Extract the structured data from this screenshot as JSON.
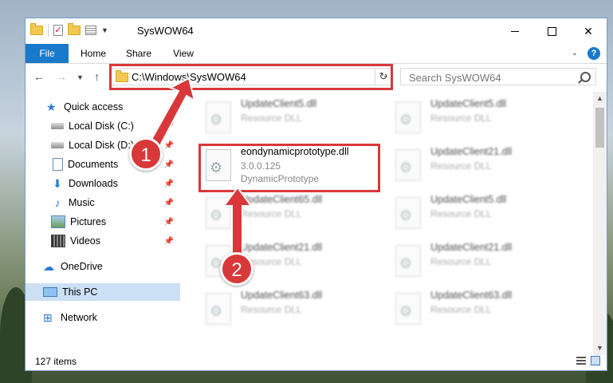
{
  "window": {
    "title": "SysWOW64"
  },
  "ribbon": {
    "tabs": [
      "File",
      "Home",
      "Share",
      "View"
    ]
  },
  "nav": {
    "address": "C:\\Windows\\SysWOW64",
    "search_placeholder": "Search SysWOW64"
  },
  "sidebar": {
    "items": [
      {
        "label": "Quick access",
        "icon": "star-icon"
      },
      {
        "label": "Local Disk (C:)",
        "icon": "disk-icon"
      },
      {
        "label": "Local Disk (D:)",
        "icon": "disk-icon"
      },
      {
        "label": "Documents",
        "icon": "document-icon"
      },
      {
        "label": "Downloads",
        "icon": "download-icon"
      },
      {
        "label": "Music",
        "icon": "music-icon"
      },
      {
        "label": "Pictures",
        "icon": "pictures-icon"
      },
      {
        "label": "Videos",
        "icon": "video-icon"
      },
      {
        "label": "OneDrive",
        "icon": "cloud-icon"
      },
      {
        "label": "This PC",
        "icon": "computer-icon"
      },
      {
        "label": "Network",
        "icon": "network-icon"
      }
    ]
  },
  "files": [
    {
      "name": "UpdateClient5.dll",
      "line1": "Resource DLL",
      "line2": ""
    },
    {
      "name": "UpdateClient5.dll",
      "line1": "Resource DLL",
      "line2": ""
    },
    {
      "name": "eondynamicprototype.dll",
      "line1": "3.0.0.125",
      "line2": "DynamicPrototype"
    },
    {
      "name": "UpdateClient21.dll",
      "line1": "Resource DLL",
      "line2": ""
    },
    {
      "name": "UpdateClient65.dll",
      "line1": "Resource DLL",
      "line2": ""
    },
    {
      "name": "UpdateClient5.dll",
      "line1": "Resource DLL",
      "line2": ""
    },
    {
      "name": "UpdateClient21.dll",
      "line1": "Resource DLL",
      "line2": ""
    },
    {
      "name": "UpdateClient21.dll",
      "line1": "Resource DLL",
      "line2": ""
    },
    {
      "name": "UpdateClient63.dll",
      "line1": "Resource DLL",
      "line2": ""
    },
    {
      "name": "UpdateClient63.dll",
      "line1": "Resource DLL",
      "line2": ""
    }
  ],
  "status": {
    "items_count": "127 items"
  },
  "annotations": {
    "step1": "1",
    "step2": "2"
  },
  "colors": {
    "accent": "#1979ca",
    "highlight": "#d9383a",
    "selected": "#cce0f5"
  }
}
